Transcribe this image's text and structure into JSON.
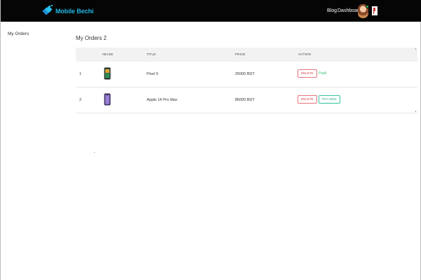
{
  "app": {
    "brand": "Mobile Bechi"
  },
  "nav": {
    "blog": "Blog",
    "dashboard": "Dashboard"
  },
  "sidebar": {
    "items": [
      {
        "label": "My Orders"
      }
    ]
  },
  "main": {
    "title": "My Orders 2"
  },
  "table": {
    "headers": [
      "",
      "IMAGE",
      "TITLE",
      "PRICE",
      "ACTION"
    ],
    "rows": [
      {
        "index": "1",
        "title": "Pixel 5",
        "price": "25000 BDT",
        "delete_label": "DELETE",
        "status": "Paid",
        "paid": true
      },
      {
        "index": "2",
        "title": "Apple 14 Pro Max",
        "price": "85000 BDT",
        "delete_label": "DELETE",
        "pay_label": "PAY NOW",
        "paid": false
      }
    ]
  },
  "colors": {
    "topbar": "#050505",
    "brand": "#22b8e6",
    "delete": "#e23a4a",
    "paid": "#37c46e",
    "pay": "#23a985"
  }
}
